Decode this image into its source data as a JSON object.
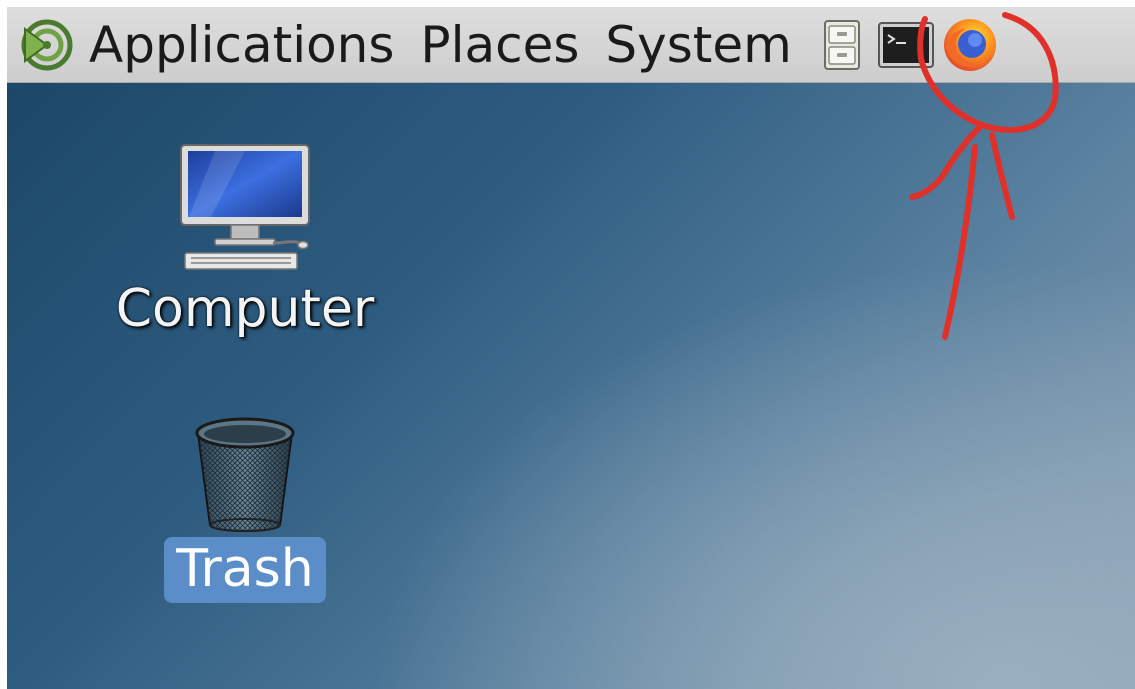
{
  "panel": {
    "menus": [
      {
        "label": "Applications"
      },
      {
        "label": "Places"
      },
      {
        "label": "System"
      }
    ],
    "launchers": [
      {
        "icon": "file-cabinet-icon"
      },
      {
        "icon": "terminal-icon"
      },
      {
        "icon": "firefox-icon"
      }
    ]
  },
  "desktop": {
    "icons": [
      {
        "label": "Computer",
        "icon": "computer-icon",
        "selected": false
      },
      {
        "label": "Trash",
        "icon": "trash-icon",
        "selected": true
      }
    ]
  },
  "colors": {
    "panel_bg": "#d6d6d6",
    "desktop_dark": "#1c4768",
    "desktop_light": "#8ba2b6",
    "selection": "#5b8ec9",
    "annotation": "#e0302a"
  }
}
